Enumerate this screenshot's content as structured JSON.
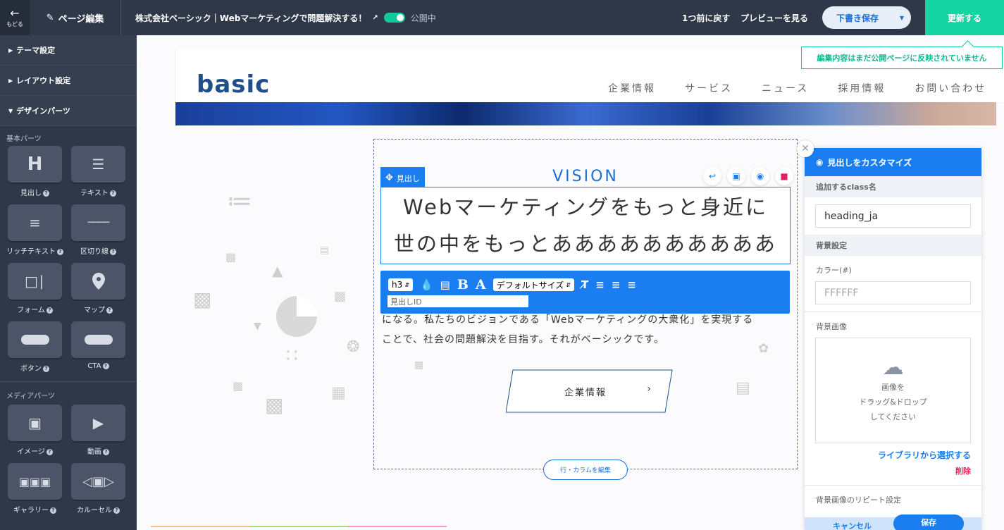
{
  "topbar": {
    "back_label": "もどる",
    "page_edit": "ページ編集",
    "page_title": "株式会社ベーシック｜Webマーケティングで問題解決する！",
    "publish_status": "公開中",
    "back_one": "1つ前に戻す",
    "preview": "プレビューを見る",
    "save_draft": "下書き保存",
    "update": "更新する",
    "notice": "編集内容はまだ公開ページに反映されていません"
  },
  "sidebar": {
    "sections": [
      "テーマ設定",
      "レイアウト設定",
      "デザインパーツ"
    ],
    "basic_parts_title": "基本パーツ",
    "basic_parts": [
      {
        "label": "見出し",
        "icon": "heading-icon"
      },
      {
        "label": "テキスト",
        "icon": "text-icon"
      },
      {
        "label": "リッチテキスト",
        "icon": "rich-text-icon"
      },
      {
        "label": "区切り線",
        "icon": "divider-icon"
      },
      {
        "label": "フォーム",
        "icon": "form-icon"
      },
      {
        "label": "マップ",
        "icon": "map-pin-icon"
      },
      {
        "label": "ボタン",
        "icon": "button-icon"
      },
      {
        "label": "CTA",
        "icon": "cta-icon"
      }
    ],
    "media_parts_title": "メディアパーツ",
    "media_parts": [
      {
        "label": "イメージ",
        "icon": "image-icon"
      },
      {
        "label": "動画",
        "icon": "video-icon"
      },
      {
        "label": "ギャラリー",
        "icon": "gallery-icon"
      },
      {
        "label": "カルーセル",
        "icon": "carousel-icon"
      }
    ],
    "help_mark": "?"
  },
  "site": {
    "logo": "basic",
    "nav": [
      "企業情報",
      "サービス",
      "ニュース",
      "採用情報",
      "お問い合わせ"
    ],
    "vision": "VISION",
    "heading_lines": [
      "Webマーケティングをもっと身近に",
      "世の中をもっとああああああああああ"
    ],
    "body_line1": "になる。私たちのビジョンである「Webマーケティングの大衆化」を実現する",
    "body_line2": "ことで、社会の問題解決を目指す。それがベーシックです。",
    "corp_button": "企業情報",
    "row_edit": "行・カラムを編集"
  },
  "editor": {
    "tag_label": "見出し",
    "heading_level": "h3",
    "font_size": "デフォルトサイズ",
    "id_placeholder": "見出しID"
  },
  "panel": {
    "title": "見出しをカスタマイズ",
    "class_label": "追加するclass名",
    "class_value": "heading_ja",
    "bg_label": "背景設定",
    "color_label": "カラー(#)",
    "color_placeholder": "FFFFFF",
    "bg_image_label": "背景画像",
    "drop_line1": "画像を",
    "drop_line2": "ドラッグ&ドロップ",
    "drop_line3": "してください",
    "library_link": "ライブラリから選択する",
    "delete_link": "削除",
    "repeat_label": "背景画像のリピート設定",
    "cancel": "キャンセル",
    "save": "保存"
  },
  "colors": {
    "topbar_bg": "#2f3848",
    "accent_blue": "#1a7ef0",
    "update_green": "#14d4a2",
    "delete_red": "#e0245e",
    "logo_navy": "#1e4f8a"
  }
}
